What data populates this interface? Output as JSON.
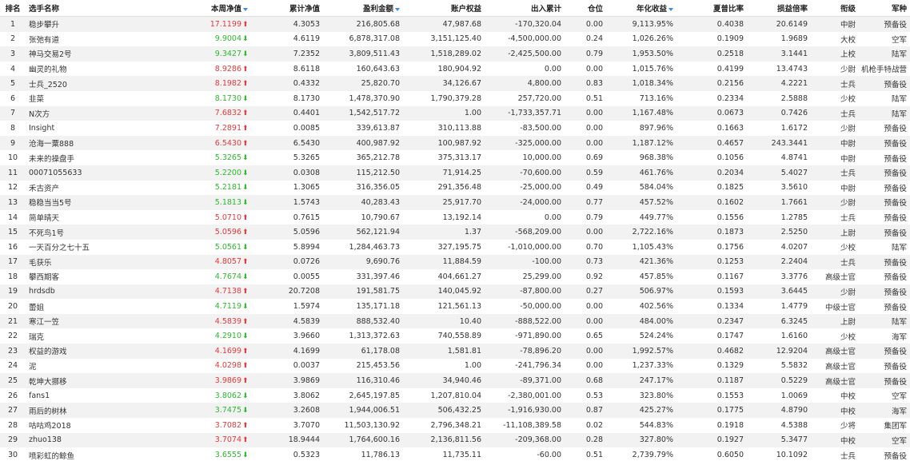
{
  "colors": {
    "up": "#e4393c",
    "down": "#2db82d",
    "sort_icon": "#3a8ee6",
    "row_alt": "#f2f2f2"
  },
  "headers": {
    "rank": "排名",
    "name": "选手名称",
    "week_nav": "本周净值",
    "cum_nav": "累计净值",
    "profit": "盈利金额",
    "equity": "账户权益",
    "io": "出入累计",
    "position": "仓位",
    "annual": "年化收益",
    "sharpe": "夏普比率",
    "pl_ratio": "损益倍率",
    "rank_title": "衔级",
    "branch": "军种"
  },
  "sortable_icons": [
    "week_nav",
    "profit",
    "annual"
  ],
  "rows": [
    {
      "rank": "1",
      "name": "稳步攀升",
      "week_nav": "17.1199",
      "dir": "up",
      "cum_nav": "4.3053",
      "profit": "216,805.68",
      "equity": "47,987.68",
      "io": "-170,320.04",
      "position": "0.00",
      "annual": "9,113.95%",
      "sharpe": "0.4038",
      "pl_ratio": "20.6149",
      "rank_title": "中尉",
      "branch": "预备役"
    },
    {
      "rank": "2",
      "name": "张弛有道",
      "week_nav": "9.9004",
      "dir": "down",
      "cum_nav": "4.6119",
      "profit": "6,878,317.08",
      "equity": "3,151,125.40",
      "io": "-4,500,000.00",
      "position": "0.24",
      "annual": "1,026.26%",
      "sharpe": "0.1909",
      "pl_ratio": "1.9689",
      "rank_title": "大校",
      "branch": "空军"
    },
    {
      "rank": "3",
      "name": "神马交易2号",
      "week_nav": "9.3427",
      "dir": "down",
      "cum_nav": "7.2352",
      "profit": "3,809,511.43",
      "equity": "1,518,289.02",
      "io": "-2,425,500.00",
      "position": "0.79",
      "annual": "1,953.50%",
      "sharpe": "0.2518",
      "pl_ratio": "3.1441",
      "rank_title": "上校",
      "branch": "陆军"
    },
    {
      "rank": "4",
      "name": "幽灵的礼物",
      "week_nav": "8.9286",
      "dir": "up",
      "cum_nav": "8.6118",
      "profit": "160,643.63",
      "equity": "180,904.92",
      "io": "0.00",
      "position": "0.00",
      "annual": "1,015.76%",
      "sharpe": "0.4199",
      "pl_ratio": "13.4743",
      "rank_title": "少尉",
      "branch": "机枪手特战营"
    },
    {
      "rank": "5",
      "name": "士兵_2520",
      "week_nav": "8.1982",
      "dir": "up",
      "cum_nav": "0.4332",
      "profit": "25,820.70",
      "equity": "34,126.67",
      "io": "4,800.00",
      "position": "0.83",
      "annual": "1,018.34%",
      "sharpe": "0.2156",
      "pl_ratio": "4.2221",
      "rank_title": "士兵",
      "branch": "预备役"
    },
    {
      "rank": "6",
      "name": "韭菜",
      "week_nav": "8.1730",
      "dir": "down",
      "cum_nav": "8.1730",
      "profit": "1,478,370.90",
      "equity": "1,790,379.28",
      "io": "257,720.00",
      "position": "0.51",
      "annual": "713.16%",
      "sharpe": "0.2334",
      "pl_ratio": "2.5888",
      "rank_title": "少校",
      "branch": "陆军"
    },
    {
      "rank": "7",
      "name": "N次方",
      "week_nav": "7.6832",
      "dir": "up",
      "cum_nav": "0.4401",
      "profit": "1,542,517.72",
      "equity": "1.00",
      "io": "-1,733,357.71",
      "position": "0.00",
      "annual": "1,167.48%",
      "sharpe": "0.0673",
      "pl_ratio": "0.7426",
      "rank_title": "士兵",
      "branch": "陆军"
    },
    {
      "rank": "8",
      "name": "Insight",
      "week_nav": "7.2891",
      "dir": "up",
      "cum_nav": "0.0085",
      "profit": "339,613.87",
      "equity": "310,113.88",
      "io": "-83,500.00",
      "position": "0.00",
      "annual": "897.96%",
      "sharpe": "0.1663",
      "pl_ratio": "1.6172",
      "rank_title": "少尉",
      "branch": "预备役"
    },
    {
      "rank": "9",
      "name": "沧海一粟888",
      "week_nav": "6.5430",
      "dir": "up",
      "cum_nav": "6.5430",
      "profit": "400,987.92",
      "equity": "100,987.92",
      "io": "-325,000.00",
      "position": "0.00",
      "annual": "1,187.12%",
      "sharpe": "0.4657",
      "pl_ratio": "243.3441",
      "rank_title": "中尉",
      "branch": "预备役"
    },
    {
      "rank": "10",
      "name": "未来的操盘手",
      "week_nav": "5.3265",
      "dir": "down",
      "cum_nav": "5.3265",
      "profit": "365,212.78",
      "equity": "375,313.17",
      "io": "10,000.00",
      "position": "0.69",
      "annual": "968.38%",
      "sharpe": "0.1056",
      "pl_ratio": "4.8741",
      "rank_title": "中尉",
      "branch": "预备役"
    },
    {
      "rank": "11",
      "name": "00071055633",
      "week_nav": "5.2200",
      "dir": "down",
      "cum_nav": "0.0308",
      "profit": "115,212.50",
      "equity": "71,914.25",
      "io": "-70,600.00",
      "position": "0.59",
      "annual": "461.76%",
      "sharpe": "0.2034",
      "pl_ratio": "5.4027",
      "rank_title": "士兵",
      "branch": "预备役"
    },
    {
      "rank": "12",
      "name": "禾古资产",
      "week_nav": "5.2181",
      "dir": "down",
      "cum_nav": "1.3065",
      "profit": "316,356.05",
      "equity": "291,356.48",
      "io": "-25,000.00",
      "position": "0.49",
      "annual": "584.04%",
      "sharpe": "0.1825",
      "pl_ratio": "3.5610",
      "rank_title": "中尉",
      "branch": "预备役"
    },
    {
      "rank": "13",
      "name": "稳稳当当5号",
      "week_nav": "5.1813",
      "dir": "down",
      "cum_nav": "1.5743",
      "profit": "40,283.43",
      "equity": "25,917.70",
      "io": "-24,000.00",
      "position": "0.77",
      "annual": "457.52%",
      "sharpe": "0.1602",
      "pl_ratio": "1.7661",
      "rank_title": "少尉",
      "branch": "预备役"
    },
    {
      "rank": "14",
      "name": "简单晴天",
      "week_nav": "5.0710",
      "dir": "up",
      "cum_nav": "0.7615",
      "profit": "10,790.67",
      "equity": "13,192.14",
      "io": "0.00",
      "position": "0.79",
      "annual": "449.77%",
      "sharpe": "0.1556",
      "pl_ratio": "1.2785",
      "rank_title": "士兵",
      "branch": "预备役"
    },
    {
      "rank": "15",
      "name": "不死鸟1号",
      "week_nav": "5.0596",
      "dir": "up",
      "cum_nav": "5.0596",
      "profit": "562,121.94",
      "equity": "1.37",
      "io": "-568,209.00",
      "position": "0.00",
      "annual": "2,722.16%",
      "sharpe": "0.1873",
      "pl_ratio": "2.5250",
      "rank_title": "上尉",
      "branch": "预备役"
    },
    {
      "rank": "16",
      "name": "一天百分之七十五",
      "week_nav": "5.0561",
      "dir": "down",
      "cum_nav": "5.8994",
      "profit": "1,284,463.73",
      "equity": "327,195.75",
      "io": "-1,010,000.00",
      "position": "0.70",
      "annual": "1,105.43%",
      "sharpe": "0.1756",
      "pl_ratio": "4.0207",
      "rank_title": "少校",
      "branch": "陆军"
    },
    {
      "rank": "17",
      "name": "毛获乐",
      "week_nav": "4.8057",
      "dir": "up",
      "cum_nav": "0.0726",
      "profit": "9,690.76",
      "equity": "11,884.59",
      "io": "-100.00",
      "position": "0.73",
      "annual": "421.36%",
      "sharpe": "0.1253",
      "pl_ratio": "2.2404",
      "rank_title": "士兵",
      "branch": "预备役"
    },
    {
      "rank": "18",
      "name": "攀西期客",
      "week_nav": "4.7674",
      "dir": "down",
      "cum_nav": "0.0055",
      "profit": "331,397.46",
      "equity": "404,661.27",
      "io": "25,299.00",
      "position": "0.92",
      "annual": "457.85%",
      "sharpe": "0.1167",
      "pl_ratio": "3.3776",
      "rank_title": "高级士官",
      "branch": "预备役"
    },
    {
      "rank": "19",
      "name": "hrdsdb",
      "week_nav": "4.7138",
      "dir": "up",
      "cum_nav": "20.7208",
      "profit": "191,581.75",
      "equity": "140,045.92",
      "io": "-87,800.00",
      "position": "0.27",
      "annual": "506.97%",
      "sharpe": "0.1593",
      "pl_ratio": "3.6445",
      "rank_title": "少尉",
      "branch": "预备役"
    },
    {
      "rank": "20",
      "name": "蕾姐",
      "week_nav": "4.7119",
      "dir": "down",
      "cum_nav": "1.5974",
      "profit": "135,171.18",
      "equity": "121,561.13",
      "io": "-50,000.00",
      "position": "0.00",
      "annual": "402.56%",
      "sharpe": "0.1334",
      "pl_ratio": "1.4779",
      "rank_title": "中级士官",
      "branch": "预备役"
    },
    {
      "rank": "21",
      "name": "寒江一笠",
      "week_nav": "4.5839",
      "dir": "up",
      "cum_nav": "4.5839",
      "profit": "888,532.40",
      "equity": "10.40",
      "io": "-888,522.00",
      "position": "0.00",
      "annual": "484.00%",
      "sharpe": "0.2347",
      "pl_ratio": "6.3245",
      "rank_title": "上尉",
      "branch": "陆军"
    },
    {
      "rank": "22",
      "name": "瑞克",
      "week_nav": "4.2910",
      "dir": "down",
      "cum_nav": "3.9660",
      "profit": "1,313,372.63",
      "equity": "740,558.89",
      "io": "-971,890.00",
      "position": "0.65",
      "annual": "524.24%",
      "sharpe": "0.1747",
      "pl_ratio": "1.6160",
      "rank_title": "少校",
      "branch": "海军"
    },
    {
      "rank": "23",
      "name": "权益的游戏",
      "week_nav": "4.1699",
      "dir": "up",
      "cum_nav": "4.1699",
      "profit": "61,178.08",
      "equity": "1,581.81",
      "io": "-78,896.20",
      "position": "0.00",
      "annual": "1,992.57%",
      "sharpe": "0.4682",
      "pl_ratio": "12.9204",
      "rank_title": "高级士官",
      "branch": "预备役"
    },
    {
      "rank": "24",
      "name": "泥",
      "week_nav": "4.0298",
      "dir": "up",
      "cum_nav": "0.0037",
      "profit": "215,453.56",
      "equity": "1.00",
      "io": "-241,796.34",
      "position": "0.00",
      "annual": "1,237.33%",
      "sharpe": "0.1329",
      "pl_ratio": "5.5832",
      "rank_title": "高级士官",
      "branch": "预备役"
    },
    {
      "rank": "25",
      "name": "乾坤大挪移",
      "week_nav": "3.9869",
      "dir": "up",
      "cum_nav": "3.9869",
      "profit": "116,310.46",
      "equity": "34,940.46",
      "io": "-89,371.00",
      "position": "0.68",
      "annual": "247.17%",
      "sharpe": "0.1187",
      "pl_ratio": "0.5229",
      "rank_title": "高级士官",
      "branch": "预备役"
    },
    {
      "rank": "26",
      "name": "fans1",
      "week_nav": "3.8062",
      "dir": "down",
      "cum_nav": "3.8062",
      "profit": "2,645,197.85",
      "equity": "1,207,810.04",
      "io": "-2,380,001.00",
      "position": "0.53",
      "annual": "323.80%",
      "sharpe": "0.1553",
      "pl_ratio": "1.0069",
      "rank_title": "中校",
      "branch": "空军"
    },
    {
      "rank": "27",
      "name": "雨后的树林",
      "week_nav": "3.7475",
      "dir": "down",
      "cum_nav": "3.2608",
      "profit": "1,944,006.51",
      "equity": "506,432.25",
      "io": "-1,916,930.00",
      "position": "0.87",
      "annual": "425.27%",
      "sharpe": "0.1775",
      "pl_ratio": "4.8790",
      "rank_title": "中校",
      "branch": "海军"
    },
    {
      "rank": "28",
      "name": "咕咕鸡2018",
      "week_nav": "3.7082",
      "dir": "up",
      "cum_nav": "3.7070",
      "profit": "11,503,130.92",
      "equity": "2,796,348.21",
      "io": "-11,108,389.58",
      "position": "0.02",
      "annual": "544.83%",
      "sharpe": "0.1918",
      "pl_ratio": "4.5388",
      "rank_title": "少将",
      "branch": "集团军"
    },
    {
      "rank": "29",
      "name": "zhuo138",
      "week_nav": "3.7074",
      "dir": "up",
      "cum_nav": "18.9444",
      "profit": "1,764,600.16",
      "equity": "2,136,811.56",
      "io": "-209,368.00",
      "position": "0.28",
      "annual": "327.80%",
      "sharpe": "0.1927",
      "pl_ratio": "5.3477",
      "rank_title": "中校",
      "branch": "空军"
    },
    {
      "rank": "30",
      "name": "喷彩虹的鲸鱼",
      "week_nav": "3.6555",
      "dir": "down",
      "cum_nav": "0.5323",
      "profit": "11,786.13",
      "equity": "11,735.11",
      "io": "-60.00",
      "position": "0.51",
      "annual": "2,739.79%",
      "sharpe": "0.6050",
      "pl_ratio": "10.1092",
      "rank_title": "士兵",
      "branch": "预备役"
    }
  ]
}
